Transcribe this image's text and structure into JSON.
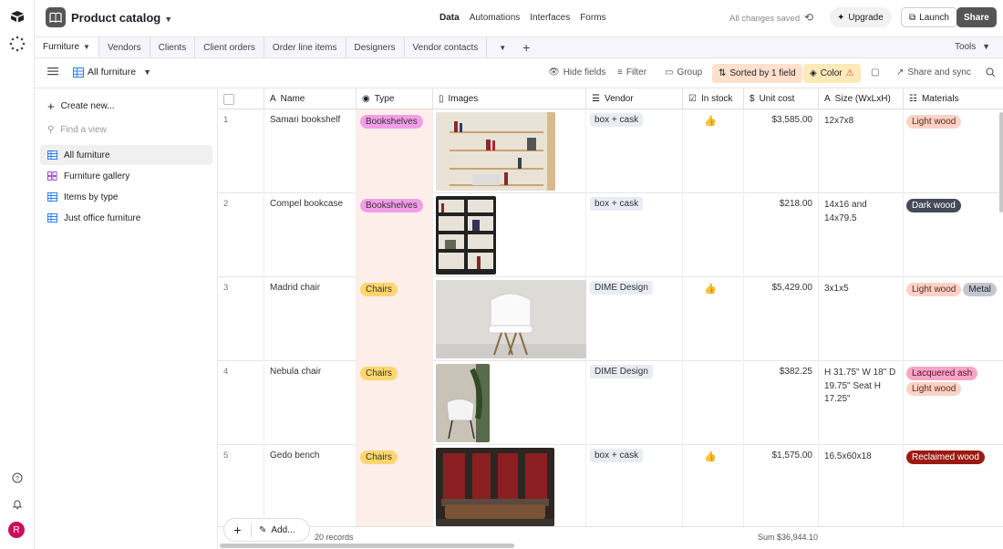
{
  "app": {
    "base_name": "Product catalog"
  },
  "nav": {
    "data": "Data",
    "automations": "Automations",
    "interfaces": "Interfaces",
    "forms": "Forms"
  },
  "status": {
    "saved": "All changes saved"
  },
  "buttons": {
    "upgrade": "Upgrade",
    "launch": "Launch",
    "share": "Share"
  },
  "tabs": [
    "Furniture",
    "Vendors",
    "Clients",
    "Client orders",
    "Order line items",
    "Designers",
    "Vendor contacts"
  ],
  "tools": "Tools",
  "view": {
    "name": "All furniture"
  },
  "toolbar": {
    "hide_fields": "Hide fields",
    "filter": "Filter",
    "group": "Group",
    "sorted": "Sorted by 1 field",
    "color": "Color",
    "share_sync": "Share and sync"
  },
  "sidebar": {
    "create_new": "Create new...",
    "find_placeholder": "Find a view",
    "views": [
      "All furniture",
      "Furniture gallery",
      "Items by type",
      "Just office furniture"
    ]
  },
  "columns": [
    "Name",
    "Type",
    "Images",
    "Vendor",
    "In stock",
    "Unit cost",
    "Size (WxLxH)",
    "Materials"
  ],
  "rows": [
    {
      "n": "1",
      "name": "Samari bookshelf",
      "type": "Bookshelves",
      "vendor": "box + cask",
      "in_stock": true,
      "cost": "$3,585.00",
      "size": "12x7x8",
      "materials": [
        "Light wood"
      ]
    },
    {
      "n": "2",
      "name": "Compel bookcase",
      "type": "Bookshelves",
      "vendor": "box + cask",
      "in_stock": false,
      "cost": "$218.00",
      "size": "14x16 and 14x79.5",
      "materials": [
        "Dark wood"
      ]
    },
    {
      "n": "3",
      "name": "Madrid chair",
      "type": "Chairs",
      "vendor": "DIME Design",
      "in_stock": true,
      "cost": "$5,429.00",
      "size": "3x1x5",
      "materials": [
        "Light wood",
        "Metal"
      ]
    },
    {
      "n": "4",
      "name": "Nebula chair",
      "type": "Chairs",
      "vendor": "DIME Design",
      "in_stock": false,
      "cost": "$382.25",
      "size": "H 31.75\" W 18\" D 19.75\" Seat H 17.25\"",
      "materials": [
        "Lacquered ash",
        "Light wood"
      ]
    },
    {
      "n": "5",
      "name": "Gedo bench",
      "type": "Chairs",
      "vendor": "box + cask",
      "in_stock": true,
      "cost": "$1,575.00",
      "size": "16.5x60x18",
      "materials": [
        "Reclaimed wood"
      ]
    }
  ],
  "footer": {
    "records": "20 records",
    "sum": "Sum $36,944.10",
    "add": "Add..."
  },
  "user": {
    "initial": "R"
  },
  "colors": {
    "bookshelves": "#f19ee8",
    "chairs": "#ffd66e",
    "light_wood": "#fcd2c6",
    "dark_wood": "#444a58",
    "metal": "#c4c7d1",
    "lacquered_ash": "#f5a6c6",
    "reclaimed_wood": "#9a1b12",
    "type_column": "#fdeee9",
    "sort_highlight": "#ffe0cc",
    "color_highlight": "#ffe9b8"
  }
}
